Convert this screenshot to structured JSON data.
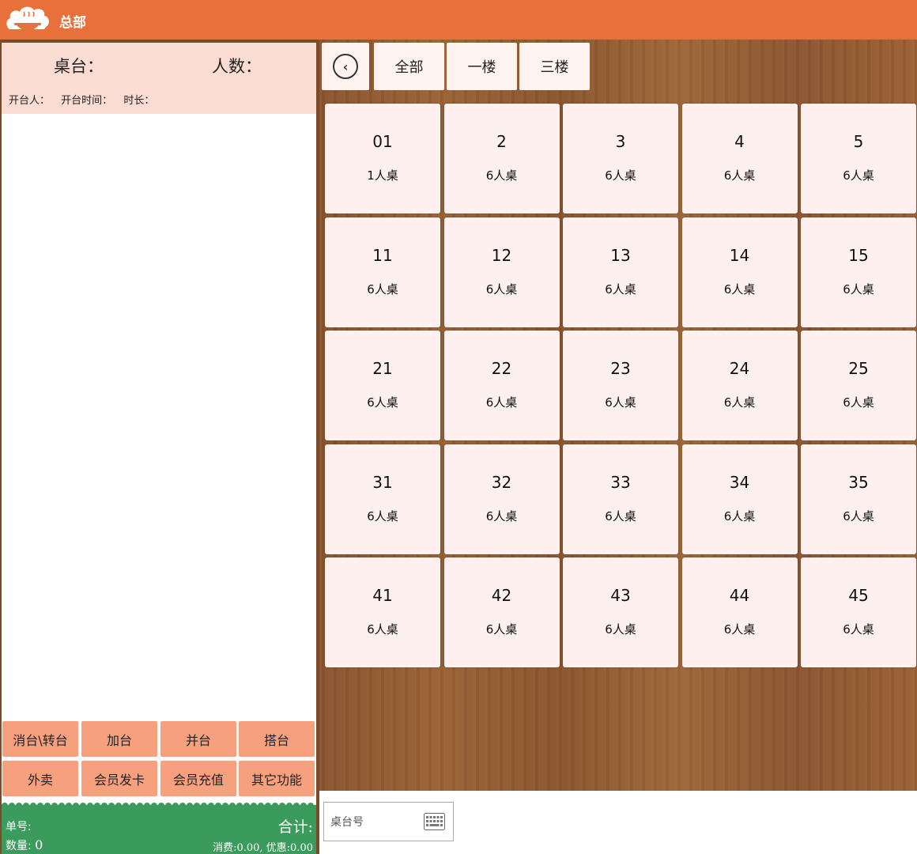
{
  "header": {
    "title": "总部",
    "logo_icon": "chef-hat-bowl-logo-icon"
  },
  "order": {
    "table_label": "桌台：",
    "people_label": "人数：",
    "opener_label": "开台人：",
    "open_time_label": "开台时间：",
    "duration_label": "时长："
  },
  "functions": [
    "消台\\转台",
    "加台",
    "并台",
    "搭台",
    "外卖",
    "会员发卡",
    "会员充值",
    "其它功能"
  ],
  "summary": {
    "order_no_label": "单号:",
    "total_label": "合计:",
    "qty_label": "数量:",
    "qty_value": "0",
    "cost_text": "消费:0.00, 优惠:0.00"
  },
  "tabs": {
    "back_icon": "back-arrow-circle-icon",
    "items": [
      "全部",
      "一楼",
      "三楼"
    ]
  },
  "tables": [
    {
      "num": "01",
      "cap": "1人桌"
    },
    {
      "num": "2",
      "cap": "6人桌"
    },
    {
      "num": "3",
      "cap": "6人桌"
    },
    {
      "num": "4",
      "cap": "6人桌"
    },
    {
      "num": "5",
      "cap": "6人桌"
    },
    {
      "num": "11",
      "cap": "6人桌"
    },
    {
      "num": "12",
      "cap": "6人桌"
    },
    {
      "num": "13",
      "cap": "6人桌"
    },
    {
      "num": "14",
      "cap": "6人桌"
    },
    {
      "num": "15",
      "cap": "6人桌"
    },
    {
      "num": "21",
      "cap": "6人桌"
    },
    {
      "num": "22",
      "cap": "6人桌"
    },
    {
      "num": "23",
      "cap": "6人桌"
    },
    {
      "num": "24",
      "cap": "6人桌"
    },
    {
      "num": "25",
      "cap": "6人桌"
    },
    {
      "num": "31",
      "cap": "6人桌"
    },
    {
      "num": "32",
      "cap": "6人桌"
    },
    {
      "num": "33",
      "cap": "6人桌"
    },
    {
      "num": "34",
      "cap": "6人桌"
    },
    {
      "num": "35",
      "cap": "6人桌"
    },
    {
      "num": "41",
      "cap": "6人桌"
    },
    {
      "num": "42",
      "cap": "6人桌"
    },
    {
      "num": "43",
      "cap": "6人桌"
    },
    {
      "num": "44",
      "cap": "6人桌"
    },
    {
      "num": "45",
      "cap": "6人桌"
    }
  ],
  "search": {
    "placeholder": "桌台号",
    "keyboard_icon": "keyboard-icon"
  },
  "colors": {
    "header": "#e8703a",
    "order_head": "#fadcd2",
    "function_button": "#f6a07e",
    "summary": "#3a9b5c",
    "table_card": "#fdf0ee"
  }
}
